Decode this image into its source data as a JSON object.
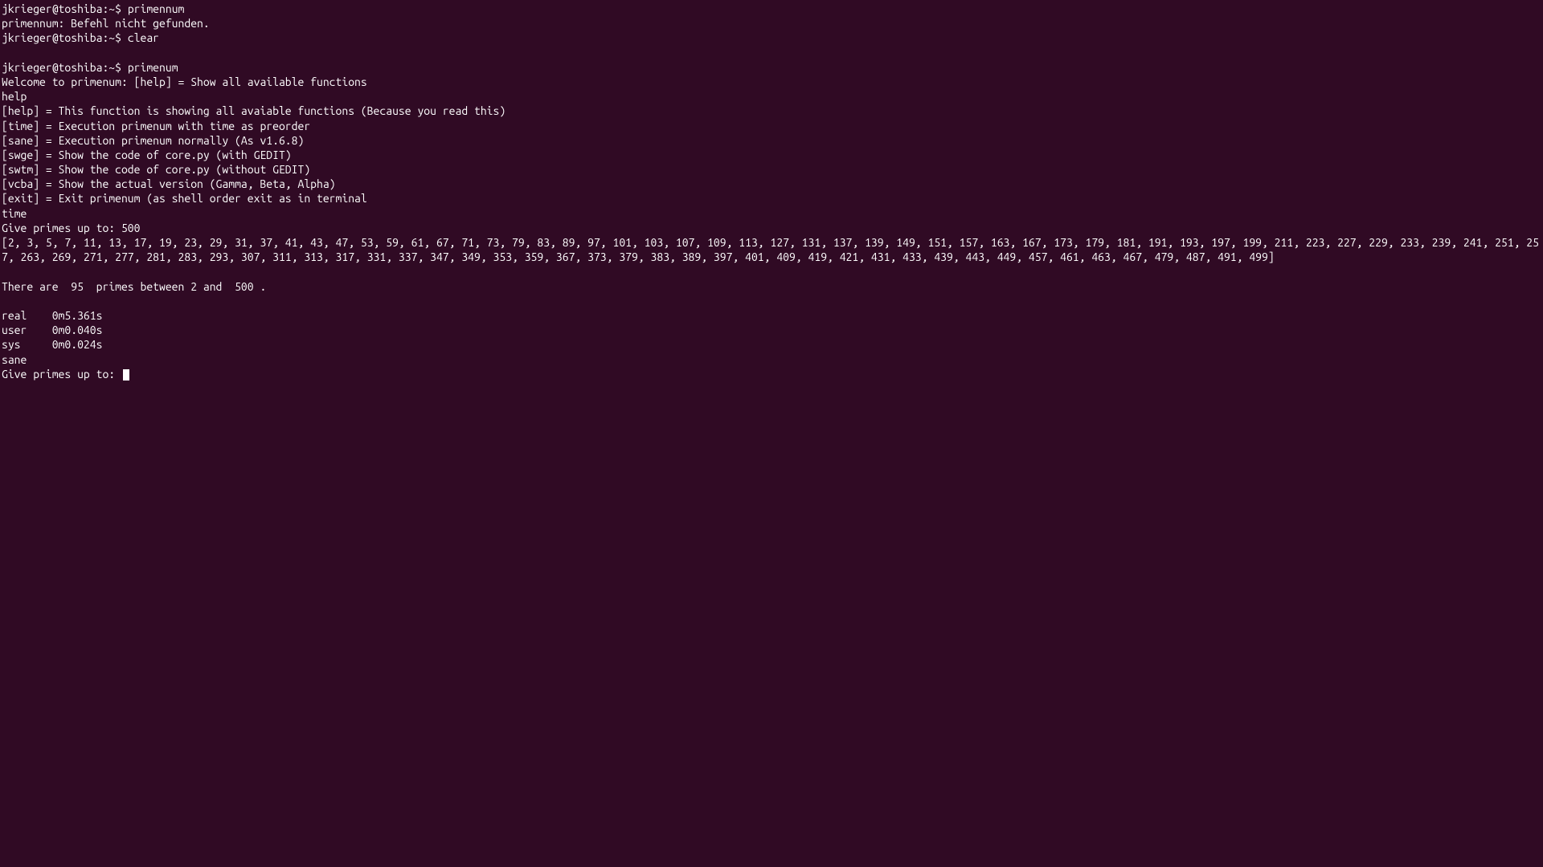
{
  "lines": {
    "l1_prompt": "jkrieger@toshiba:~$ ",
    "l1_cmd": "primennum",
    "l2": "primennum: Befehl nicht gefunden.",
    "l3_prompt": "jkrieger@toshiba:~$ ",
    "l3_cmd": "clear",
    "l4": "",
    "l5_prompt": "jkrieger@toshiba:~$ ",
    "l5_cmd": "primenum",
    "l6": "Welcome to primenum: [help] = Show all available functions",
    "l7": "help",
    "l8": "[help] = This function is showing all avaiable functions (Because you read this)",
    "l9": "[time] = Execution primenum with time as preorder",
    "l10": "[sane] = Execution primenum normally (As v1.6.8)",
    "l11": "[swge] = Show the code of core.py (with GEDIT)",
    "l12": "[swtm] = Show the code of core.py (without GEDIT)",
    "l13": "[vcba] = Show the actual version (Gamma, Beta, Alpha)",
    "l14": "[exit] = Exit primenum (as shell order exit as in terminal",
    "l15": "time",
    "l16": "Give primes up to: 500",
    "l17": "[2, 3, 5, 7, 11, 13, 17, 19, 23, 29, 31, 37, 41, 43, 47, 53, 59, 61, 67, 71, 73, 79, 83, 89, 97, 101, 103, 107, 109, 113, 127, 131, 137, 139, 149, 151, 157, 163, 167, 173, 179, 181, 191, 193, 197, 199, 211, 223, 227, 229, 233, 239, 241, 251, 257, 263, 269, 271, 277, 281, 283, 293, 307, 311, 313, 317, 331, 337, 347, 349, 353, 359, 367, 373, 379, 383, 389, 397, 401, 409, 419, 421, 431, 433, 439, 443, 449, 457, 461, 463, 467, 479, 487, 491, 499]",
    "l18": "",
    "l19": "There are  95  primes between 2 and  500 .",
    "l20": "",
    "l21": "real    0m5.361s",
    "l22": "user    0m0.040s",
    "l23": "sys     0m0.024s",
    "l24": "sane",
    "l25": "Give primes up to: "
  }
}
